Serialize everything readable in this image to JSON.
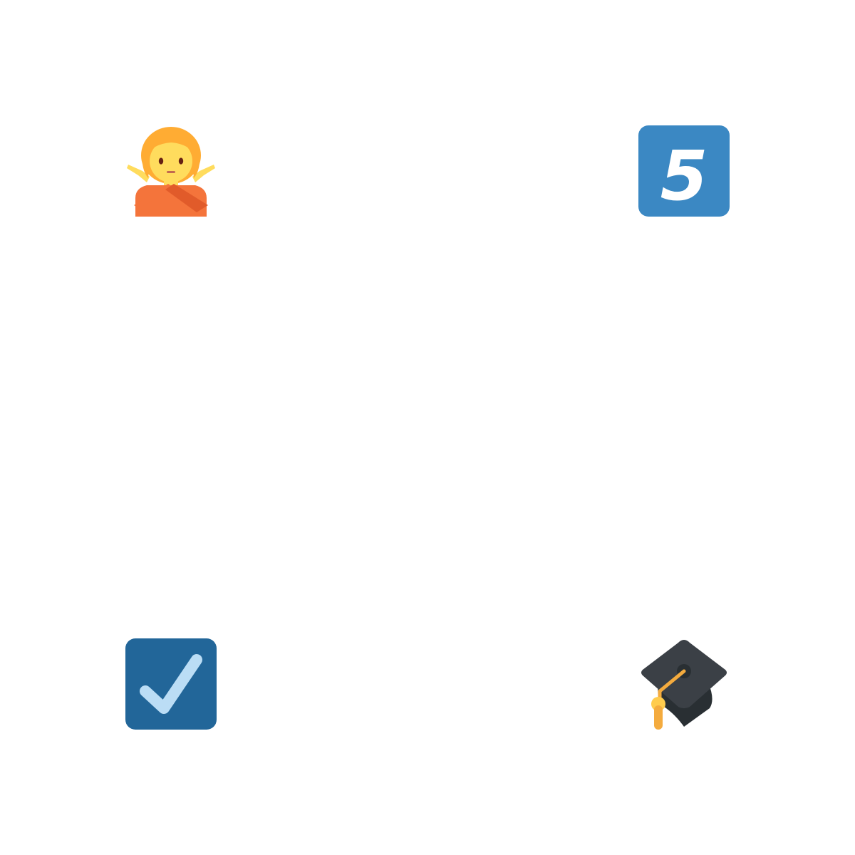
{
  "emojis": [
    {
      "name": "person-gesturing-no-icon",
      "position": "top-left"
    },
    {
      "name": "keycap-digit-five-icon",
      "position": "top-right",
      "digit": "5"
    },
    {
      "name": "check-box-with-check-icon",
      "position": "bottom-left"
    },
    {
      "name": "graduation-cap-icon",
      "position": "bottom-right"
    }
  ],
  "colors": {
    "background": "#ffffff",
    "hair": "#FFAC33",
    "skin": "#FFDC5D",
    "shirt": "#F4743B",
    "shirt_shadow": "#E15B2A",
    "keycap_blue": "#3B88C3",
    "checkbox_blue": "#226699",
    "check_light": "#BBDDF5",
    "cap_dark": "#292F33",
    "cap_top": "#3B4046",
    "tassel": "#F4AB3E"
  }
}
